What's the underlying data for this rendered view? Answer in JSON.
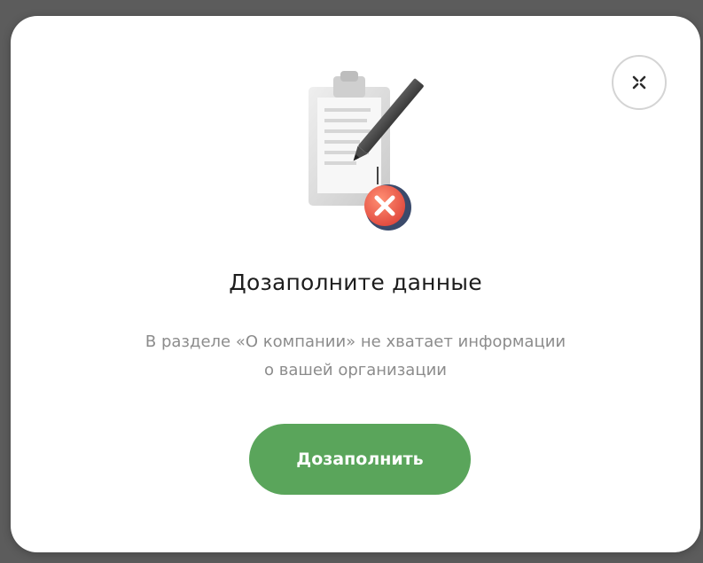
{
  "dialog": {
    "title": "Дозаполните данные",
    "description_lines": [
      "В разделе «О компании» не хватает информации",
      "о вашей организации"
    ],
    "primary_button_label": "Дозаполнить",
    "close_icon": "close-icon",
    "illustration_icon": "clipboard-error-icon"
  },
  "colors": {
    "backdrop": "#5c5c5c",
    "dialog_background": "#ffffff",
    "primary_button": "#5aa55b",
    "title_text": "#1d1d1d",
    "description_text": "#8c8c8c",
    "error_badge": "#e8574a"
  }
}
